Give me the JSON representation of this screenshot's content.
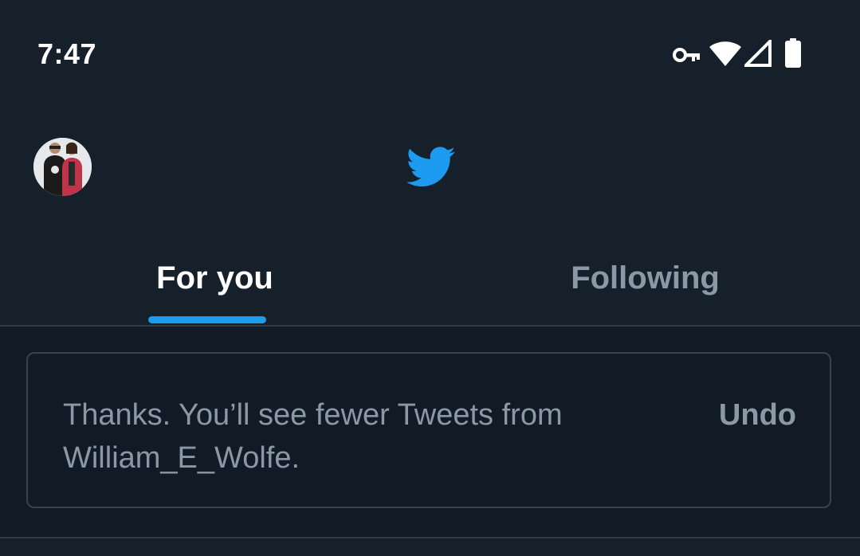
{
  "status_bar": {
    "time": "7:47",
    "icons": [
      "vpn-key-icon",
      "wifi-icon",
      "cellular-signal-icon",
      "battery-icon"
    ]
  },
  "app_bar": {
    "avatar": "profile-avatar",
    "logo": "twitter-bird-icon",
    "logo_color": "#1d9bf0"
  },
  "tabs": [
    {
      "label": "For you",
      "selected": true
    },
    {
      "label": "Following",
      "selected": false
    }
  ],
  "notice": {
    "text": "Thanks. You’ll see fewer Tweets from William_E_Wolfe.",
    "undo_label": "Undo"
  },
  "colors": {
    "background": "#15202b",
    "accent": "#1d9bf0",
    "muted_text": "#8b98a5",
    "border": "#38444d"
  }
}
